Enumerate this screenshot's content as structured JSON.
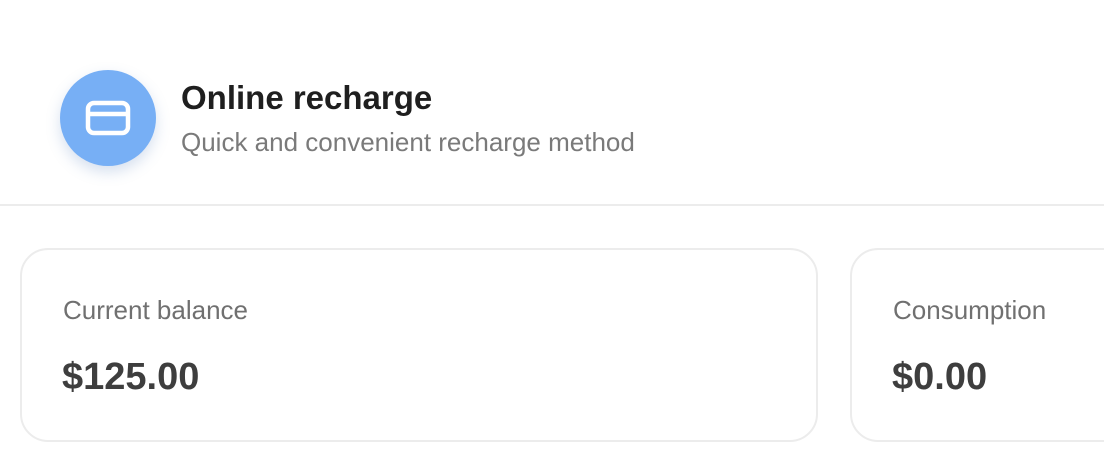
{
  "header": {
    "icon": "credit-card-icon",
    "icon_background": "#77aff5",
    "title": "Online recharge",
    "subtitle": "Quick and convenient recharge method"
  },
  "stats": [
    {
      "label": "Current balance",
      "value": "$125.00"
    },
    {
      "label": "Consumption",
      "value": "$0.00"
    }
  ]
}
